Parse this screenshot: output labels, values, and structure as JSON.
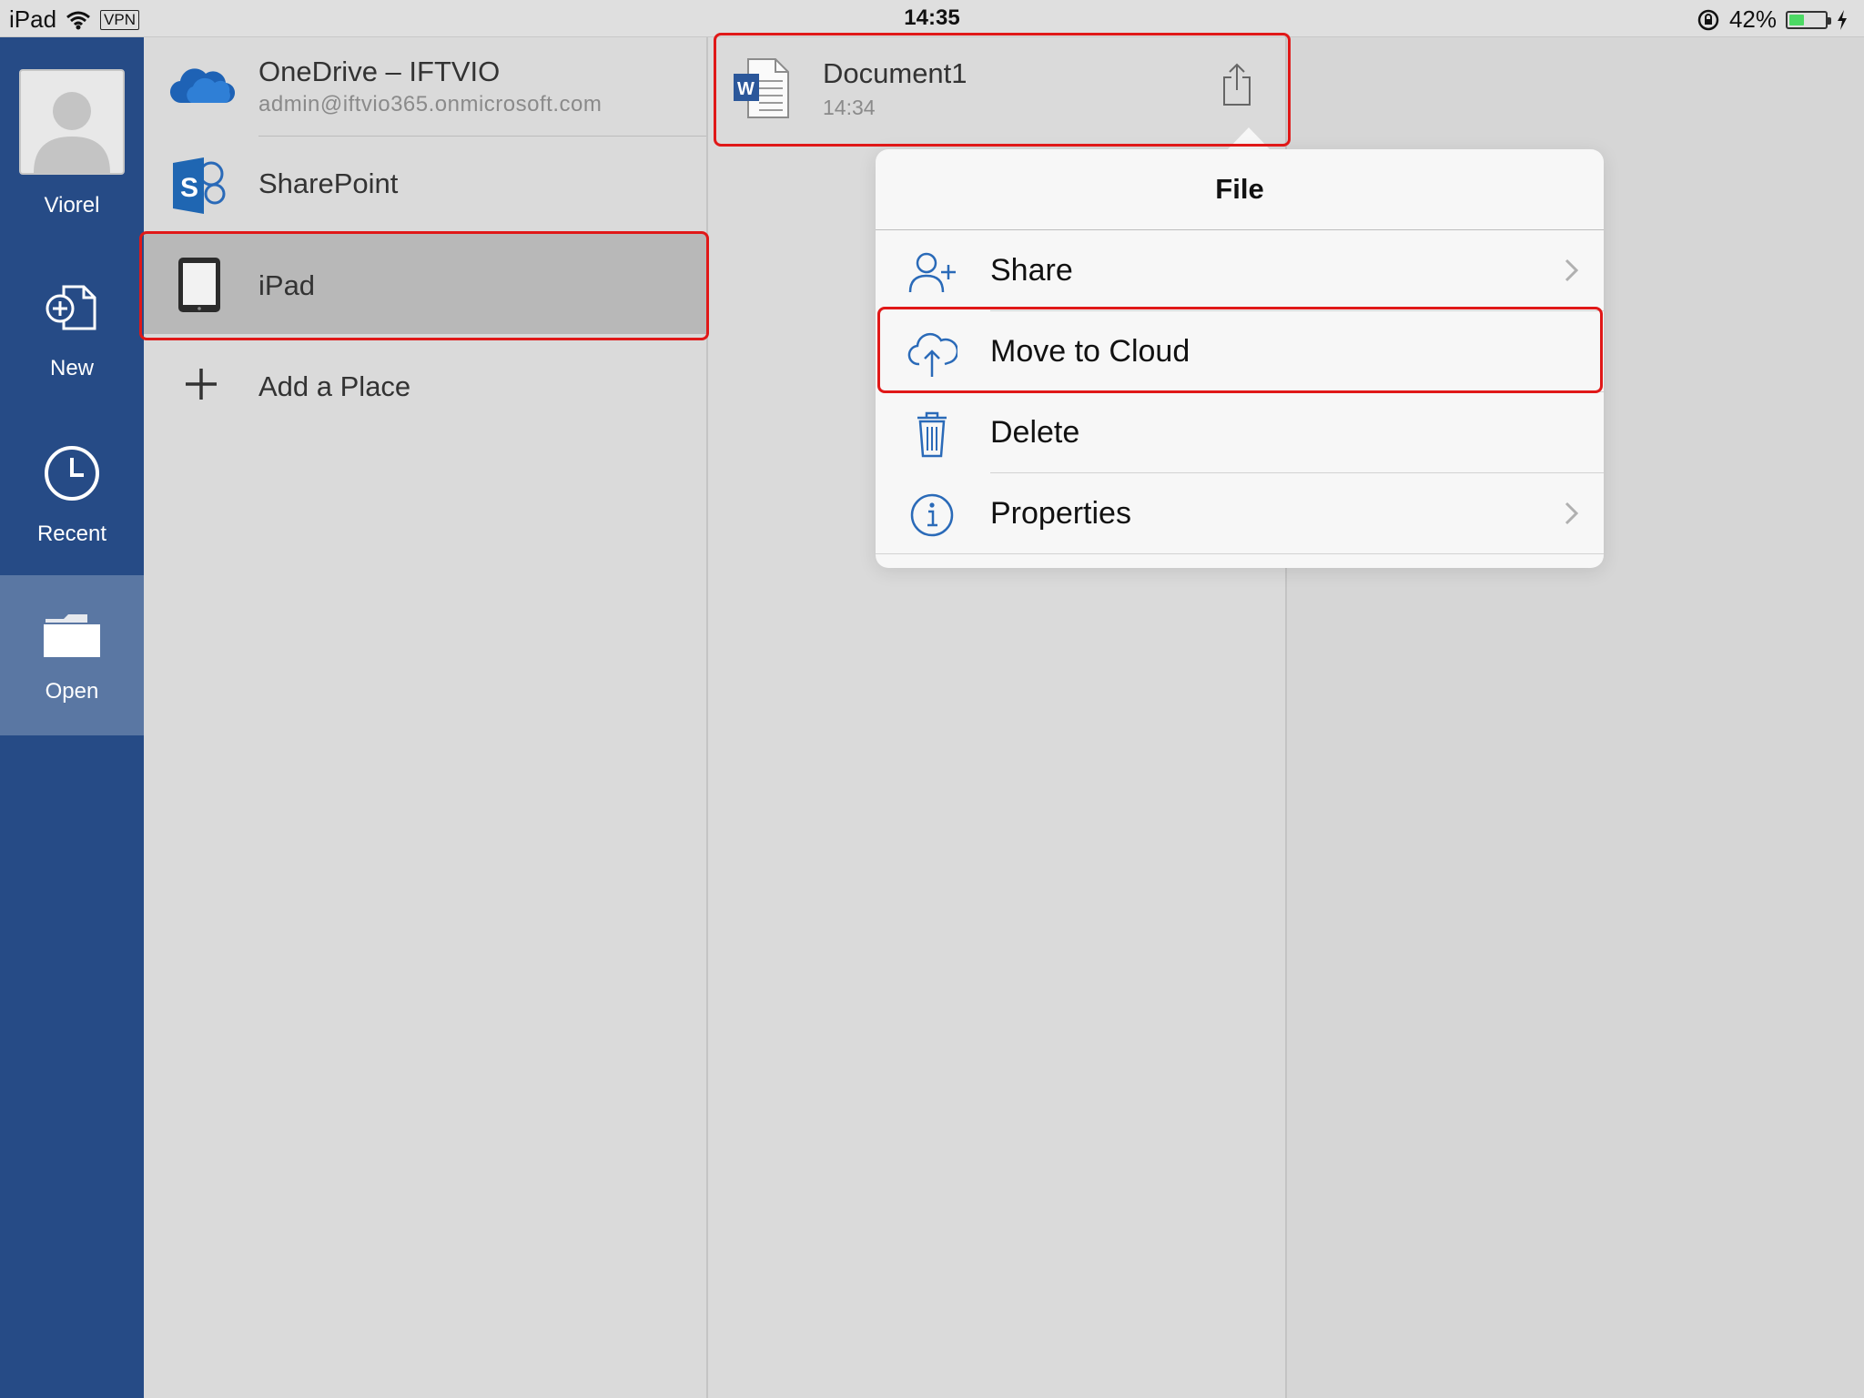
{
  "status_bar": {
    "device": "iPad",
    "vpn": "VPN",
    "time": "14:35",
    "battery_percent_text": "42%",
    "battery_level": 0.42
  },
  "nav": {
    "profile_name": "Viorel",
    "new_label": "New",
    "recent_label": "Recent",
    "open_label": "Open",
    "active": "Open"
  },
  "places": {
    "items": [
      {
        "title": "OneDrive – IFTVIO",
        "subtitle": "admin@iftvio365.onmicrosoft.com",
        "icon": "onedrive-cloud-icon"
      },
      {
        "title": "SharePoint",
        "icon": "sharepoint-icon"
      },
      {
        "title": "iPad",
        "icon": "ipad-device-icon",
        "selected": true
      },
      {
        "title": "Add a Place",
        "icon": "plus-icon"
      }
    ]
  },
  "files": {
    "items": [
      {
        "name": "Document1",
        "time": "14:34",
        "icon": "word-document-icon"
      }
    ]
  },
  "popover": {
    "title": "File",
    "items": [
      {
        "label": "Share",
        "icon": "add-person-icon",
        "chevron": true
      },
      {
        "label": "Move to Cloud",
        "icon": "cloud-upload-icon",
        "chevron": false
      },
      {
        "label": "Delete",
        "icon": "trash-icon",
        "chevron": false
      },
      {
        "label": "Properties",
        "icon": "info-icon",
        "chevron": true
      }
    ]
  },
  "colors": {
    "nav_background": "#264b86",
    "nav_active": "#5a77a3",
    "highlight": "#e01818",
    "accent_icon": "#2a6ab8",
    "word_blue": "#2b579a",
    "battery_green": "#4cd964"
  }
}
